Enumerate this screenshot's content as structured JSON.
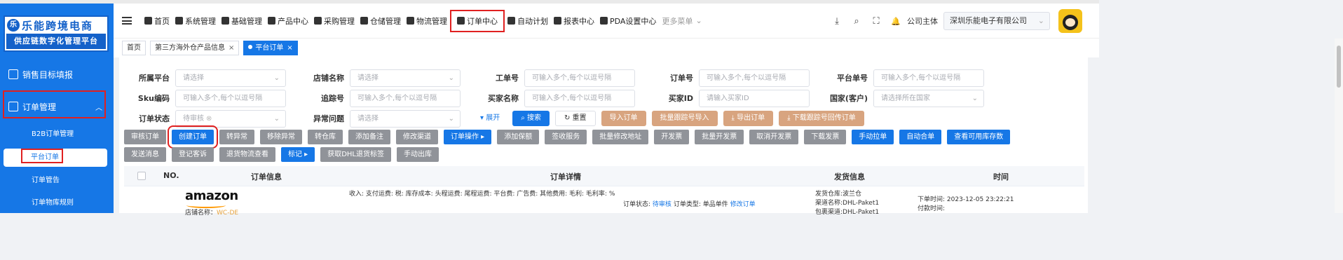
{
  "brand": {
    "mark": "乐",
    "title": "乐能跨境电商",
    "subtitle": "供应链数字化管理平台"
  },
  "sidebar": {
    "items": [
      {
        "label": "销售目标填报"
      },
      {
        "label": "订单管理",
        "expanded": true
      }
    ],
    "sub_items": [
      {
        "label": "B2B订单管理"
      },
      {
        "label": "平台订单",
        "active": true
      },
      {
        "label": "订单管告"
      },
      {
        "label": "订单物库规则"
      }
    ],
    "collapse_icon": "chevron-up-icon"
  },
  "topnav": {
    "menu": [
      {
        "label": "首页",
        "icon": "monitor-icon"
      },
      {
        "label": "系统管理",
        "icon": "system-icon"
      },
      {
        "label": "基础管理",
        "icon": "gear-icon"
      },
      {
        "label": "产品中心",
        "icon": "box-icon"
      },
      {
        "label": "采购管理",
        "icon": "purchase-icon"
      },
      {
        "label": "仓储管理",
        "icon": "warehouse-icon"
      },
      {
        "label": "物流管理",
        "icon": "logistics-icon"
      },
      {
        "label": "订单中心",
        "icon": "order-icon",
        "active": true
      },
      {
        "label": "自动计划",
        "icon": "plan-icon"
      },
      {
        "label": "报表中心",
        "icon": "report-icon"
      },
      {
        "label": "PDA设置中心",
        "icon": "pda-icon"
      }
    ],
    "more_label": "更多菜单",
    "tools": {
      "download_icon": "⤓",
      "search_icon": "⌕",
      "fullscreen_icon": "⛶",
      "bell_icon": "🔔"
    },
    "tenant_label": "公司主体",
    "tenant_value": "深圳乐能电子有限公司"
  },
  "tabs": [
    {
      "label": "首页",
      "closable": false
    },
    {
      "label": "第三方海外仓产品信息",
      "closable": true
    },
    {
      "label": "平台订单",
      "closable": true,
      "active": true
    }
  ],
  "filters": {
    "row1": [
      {
        "label": "所属平台",
        "placeholder": "请选择",
        "type": "select"
      },
      {
        "label": "店铺名称",
        "placeholder": "请选择",
        "type": "select"
      },
      {
        "label": "工单号",
        "placeholder": "可输入多个,每个以逗号隔",
        "type": "input"
      },
      {
        "label": "订单号",
        "placeholder": "可输入多个,每个以逗号隔",
        "type": "input"
      },
      {
        "label": "平台单号",
        "placeholder": "可输入多个,每个以逗号隔",
        "type": "input"
      }
    ],
    "row2": [
      {
        "label": "Sku编码",
        "placeholder": "可输入多个,每个以逗号隔",
        "type": "input"
      },
      {
        "label": "追踪号",
        "placeholder": "可输入多个,每个以逗号隔",
        "type": "input"
      },
      {
        "label": "买家名称",
        "placeholder": "可输入多个,每个以逗号隔",
        "type": "input"
      },
      {
        "label": "买家ID",
        "placeholder": "请输入买家ID",
        "type": "input"
      },
      {
        "label": "国家(客户)",
        "placeholder": "请选择所在国家",
        "type": "select"
      }
    ],
    "row3": [
      {
        "label": "订单状态",
        "value": "待审核",
        "type": "select"
      },
      {
        "label": "异常问题",
        "placeholder": "请选择",
        "type": "select"
      }
    ],
    "buttons": {
      "expand": "▾ 展开",
      "search": "⌕ 搜索",
      "reset": "↻ 重置",
      "import_orders": "导入订单",
      "batch_tracking_import": "批量跟踪号导入",
      "export_orders": "⤓ 导出订单",
      "download_tracking_return": "⤓ 下载跟踪号回传订单"
    }
  },
  "actions": {
    "row1": [
      {
        "label": "审核订单",
        "style": "gray"
      },
      {
        "label": "创建订单",
        "style": "blue",
        "highlight": true
      },
      {
        "label": "转异常",
        "style": "gray"
      },
      {
        "label": "移除异常",
        "style": "gray"
      },
      {
        "label": "转仓库",
        "style": "gray"
      },
      {
        "label": "添加备注",
        "style": "gray"
      },
      {
        "label": "修改渠道",
        "style": "gray"
      },
      {
        "label": "订单操作 ▸",
        "style": "blue"
      },
      {
        "label": "添加保额",
        "style": "gray"
      },
      {
        "label": "签收服务",
        "style": "gray"
      },
      {
        "label": "批量修改地址",
        "style": "gray"
      },
      {
        "label": "开发票",
        "style": "gray"
      },
      {
        "label": "批量开发票",
        "style": "gray"
      },
      {
        "label": "取消开发票",
        "style": "gray"
      },
      {
        "label": "下载发票",
        "style": "gray"
      },
      {
        "label": "手动拉单",
        "style": "blue"
      },
      {
        "label": "自动合单",
        "style": "blue"
      },
      {
        "label": "查看可用库存数",
        "style": "blue"
      }
    ],
    "row2": [
      {
        "label": "发送消息",
        "style": "gray"
      },
      {
        "label": "登记客诉",
        "style": "gray"
      },
      {
        "label": "退货物流查看",
        "style": "gray"
      },
      {
        "label": "标记 ▸",
        "style": "blue"
      },
      {
        "label": "获取DHL退货标签",
        "style": "gray"
      },
      {
        "label": "手动出库",
        "style": "gray"
      }
    ]
  },
  "table": {
    "headers": [
      "NO.",
      "订单信息",
      "订单详情",
      "发货信息",
      "时间"
    ],
    "row": {
      "platform_logo": "amazon",
      "store_label": "店铺名称：",
      "store_value": "WC-DE",
      "detail_line": "收入: 支付运费:   税:   库存成本:   头程运费:   尾程运费:   平台费:   广告费:   其他费用:   毛利:     毛利率:   %",
      "status_label": "订单状态:",
      "status_value": "待审核",
      "type_label": "订单类型:",
      "type_value": "单品单件",
      "edit_link": "修改订单",
      "warehouse_label": "发货仓库:",
      "warehouse_value": "波兰仓",
      "channel_label": "渠道名称:",
      "channel_value": "DHL-Paket1",
      "package_label": "包裹渠道:",
      "package_value": "DHL-Paket1",
      "order_time_label": "下单时间:",
      "order_time_value": "2023-12-05 23:22:21",
      "pay_time_label": "付款时间:",
      "pay_time_value": ""
    }
  },
  "colors": {
    "primary": "#1677e6",
    "sidebar": "#1677e6",
    "tan_button": "#d8a47f",
    "gray_button": "#909399",
    "highlight": "#e02020"
  }
}
